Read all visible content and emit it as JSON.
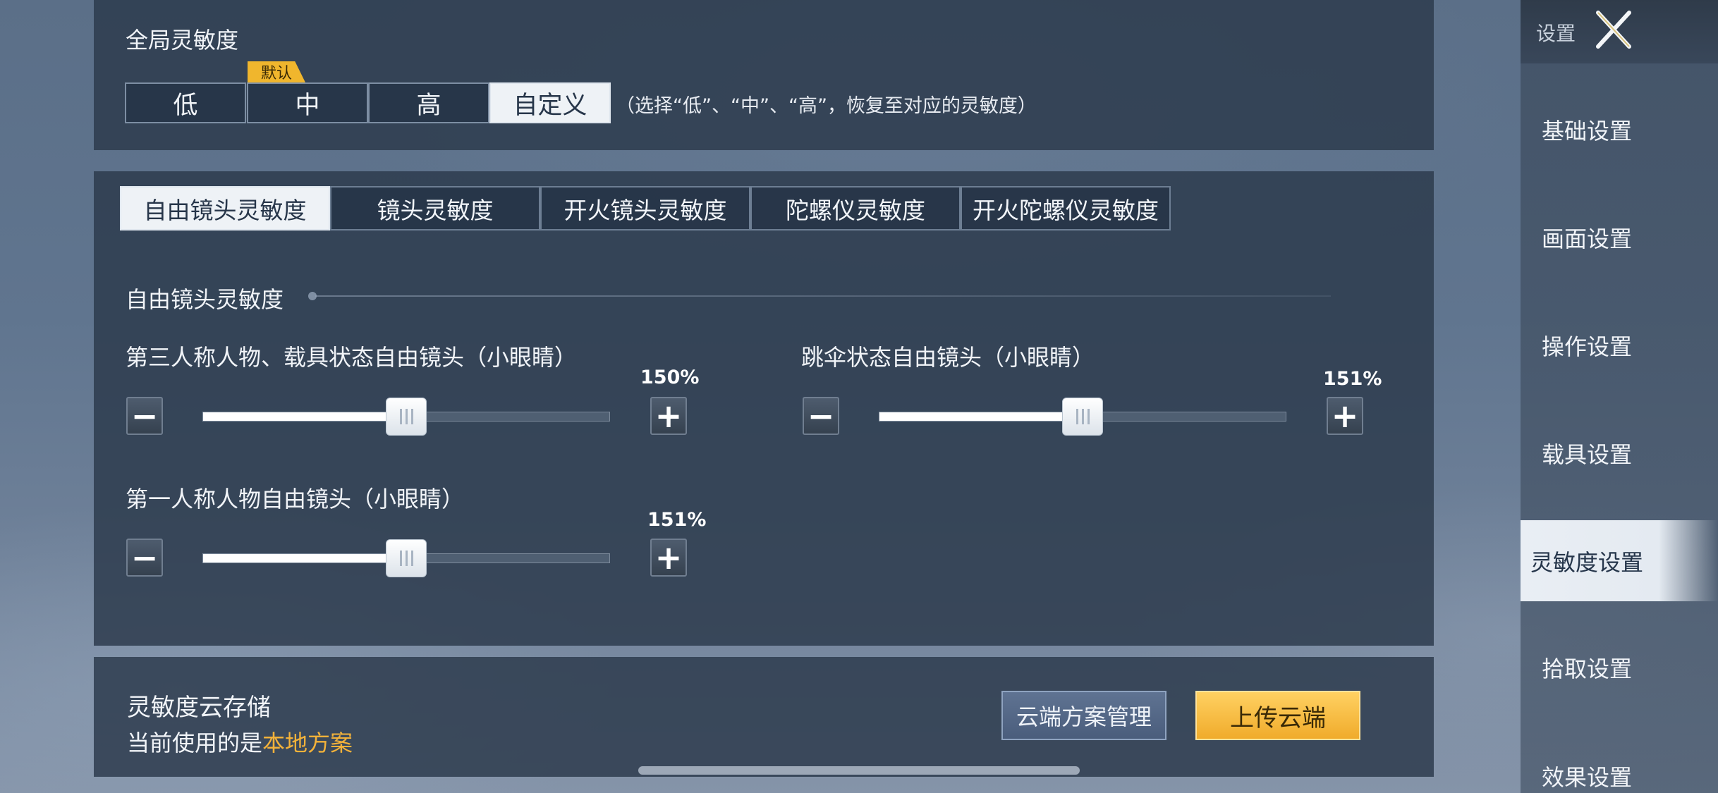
{
  "global": {
    "title": "全局灵敏度",
    "presets": [
      {
        "label": "低",
        "active": false
      },
      {
        "label": "中",
        "active": false
      },
      {
        "label": "高",
        "active": false
      },
      {
        "label": "自定义",
        "active": true
      }
    ],
    "default_badge": "默认",
    "hint": "（选择“低”、“中”、“高”，恢复至对应的灵敏度）"
  },
  "tabs": [
    {
      "label": "自由镜头灵敏度",
      "active": true
    },
    {
      "label": "镜头灵敏度",
      "active": false
    },
    {
      "label": "开火镜头灵敏度",
      "active": false
    },
    {
      "label": "陀螺仪灵敏度",
      "active": false
    },
    {
      "label": "开火陀螺仪灵敏度",
      "active": false
    }
  ],
  "section": {
    "title": "自由镜头灵敏度",
    "sliders": [
      {
        "label": "第三人称人物、载具状态自由镜头（小眼睛）",
        "value_text": "150%",
        "fill": 0.5
      },
      {
        "label": "跳伞状态自由镜头（小眼睛）",
        "value_text": "151%",
        "fill": 0.5
      },
      {
        "label": "第一人称人物自由镜头（小眼睛）",
        "value_text": "151%",
        "fill": 0.5
      }
    ],
    "minus_symbol": "−",
    "plus_symbol": "+"
  },
  "cloud": {
    "title": "灵敏度云存储",
    "sub_prefix": "当前使用的是",
    "sub_highlight": "本地方案",
    "manage_label": "云端方案管理",
    "upload_label": "上传云端"
  },
  "sidebar": {
    "header": "设置",
    "items": [
      {
        "label": "基础设置",
        "active": false
      },
      {
        "label": "画面设置",
        "active": false
      },
      {
        "label": "操作设置",
        "active": false
      },
      {
        "label": "载具设置",
        "active": false
      },
      {
        "label": "灵敏度设置",
        "active": true
      },
      {
        "label": "拾取设置",
        "active": false
      },
      {
        "label": "效果设置",
        "active": false
      }
    ]
  },
  "colors": {
    "accent_gold": "#f0b62d",
    "highlight_text": "#f3b23a",
    "panel_bg": "#2c3a4c"
  }
}
